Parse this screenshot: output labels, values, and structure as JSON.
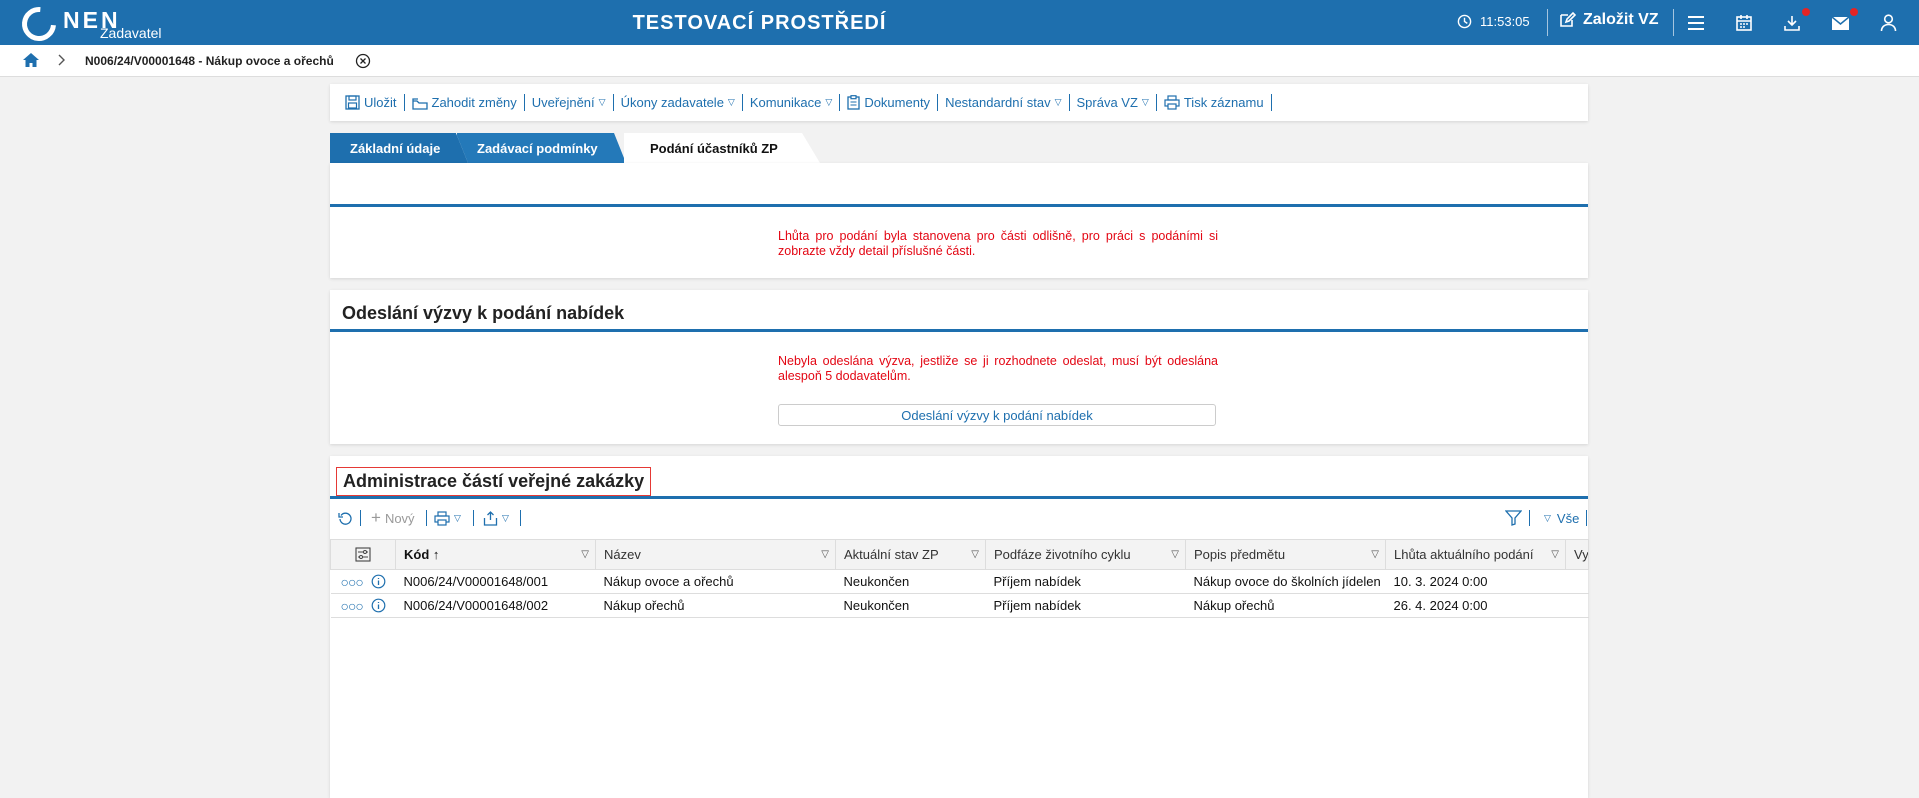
{
  "header": {
    "logo_text": "NEN",
    "logo_sub": "Zadavatel",
    "env_title": "TESTOVACÍ PROSTŘEDÍ",
    "time": "11:53:05",
    "create_label": "Založit VZ",
    "icons": [
      "clock-icon",
      "edit-icon",
      "menu-icon",
      "calendar-icon",
      "download-icon",
      "mail-icon",
      "user-icon"
    ],
    "accent_color": "#1e6fae",
    "notify_color": "#e32424"
  },
  "breadcrumb": {
    "current": "N006/24/V00001648 - Nákup ovoce a ořechů"
  },
  "toolbar": {
    "items": [
      {
        "label": "Uložit",
        "icon": "save-icon",
        "dropdown": false
      },
      {
        "label": "Zahodit změny",
        "icon": "discard-icon",
        "dropdown": false
      },
      {
        "label": "Uveřejnění",
        "dropdown": true
      },
      {
        "label": "Úkony zadavatele",
        "dropdown": true
      },
      {
        "label": "Komunikace",
        "dropdown": true
      },
      {
        "label": "Dokumenty",
        "icon": "clipboard-icon",
        "dropdown": false
      },
      {
        "label": "Nestandardní stav",
        "dropdown": true
      },
      {
        "label": "Správa VZ",
        "dropdown": true
      },
      {
        "label": "Tisk záznamu",
        "icon": "print-icon",
        "dropdown": false
      }
    ]
  },
  "tabs": [
    {
      "label": "Základní údaje",
      "active": false
    },
    {
      "label": "Zadávací podmínky",
      "active": false
    },
    {
      "label": "Podání účastníků ZP",
      "active": true
    }
  ],
  "section1": {
    "warning": "Lhůta pro podání byla stanovena pro části odlišně, pro práci s podáními si zobrazte vždy detail příslušné části."
  },
  "section2": {
    "title": "Odeslání výzvy k podání nabídek",
    "warning": "Nebyla odeslána výzva, jestliže se ji rozhodnete odeslat, musí být odeslána alespoň 5 dodavatelům.",
    "button": "Odeslání výzvy k podání nabídek"
  },
  "section3": {
    "title": "Administrace částí veřejné zakázky",
    "tools": {
      "new_label": "Nový",
      "filter_all_label": "Vše"
    },
    "columns": [
      "Kód",
      "Název",
      "Aktuální stav ZP",
      "Podfáze životního cyklu",
      "Popis předmětu",
      "Lhůta aktuálního podání",
      "Vy"
    ],
    "rows": [
      {
        "kod": "N006/24/V00001648/001",
        "nazev": "Nákup ovoce a ořechů",
        "stav": "Neukončen",
        "podfaze": "Příjem nabídek",
        "popis": "Nákup ovoce do školních jídelen",
        "lhuta": "10. 3. 2024 0:00"
      },
      {
        "kod": "N006/24/V00001648/002",
        "nazev": "Nákup ořechů",
        "stav": "Neukončen",
        "podfaze": "Příjem nabídek",
        "popis": "Nákup ořechů",
        "lhuta": "26. 4. 2024 0:00"
      }
    ]
  }
}
